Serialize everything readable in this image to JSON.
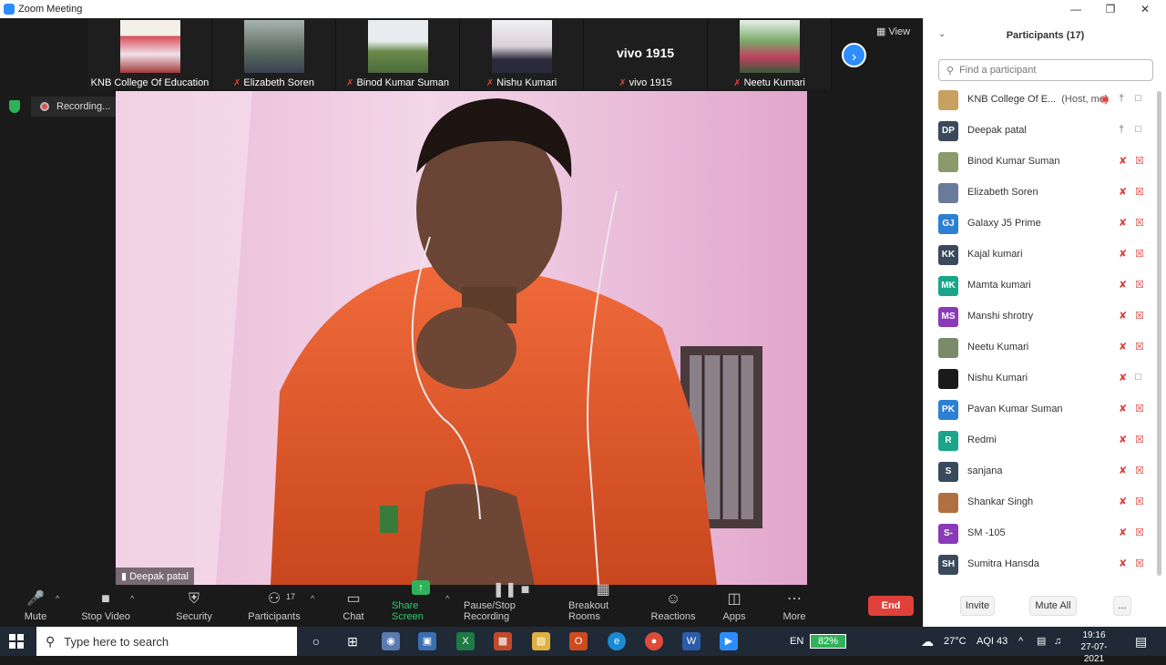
{
  "window": {
    "title": "Zoom Meeting"
  },
  "gallery": {
    "tiles": [
      {
        "name": "KNB College Of Education",
        "muted": false
      },
      {
        "name": "Elizabeth Soren",
        "muted": true
      },
      {
        "name": "Binod Kumar Suman",
        "muted": true
      },
      {
        "name": "Nishu Kumari",
        "muted": true
      },
      {
        "name": "vivo 1915",
        "muted": true,
        "display_text": "vivo 1915"
      },
      {
        "name": "Neetu Kumari",
        "muted": true
      }
    ],
    "view_label": "View"
  },
  "recording": {
    "label": "Recording..."
  },
  "active_speaker": {
    "name": "Deepak patal"
  },
  "toolbar": {
    "mute": "Mute",
    "stop_video": "Stop Video",
    "security": "Security",
    "participants": "Participants",
    "participants_count": "17",
    "chat": "Chat",
    "share_screen": "Share Screen",
    "pause_stop_recording": "Pause/Stop Recording",
    "breakout_rooms": "Breakout Rooms",
    "reactions": "Reactions",
    "apps": "Apps",
    "more": "More",
    "end": "End"
  },
  "participants_panel": {
    "title": "Participants (17)",
    "search_placeholder": "Find a participant",
    "items": [
      {
        "name": "KNB College Of E...",
        "role": "(Host, me)",
        "initials": "",
        "color": "#c8a060",
        "mic": "on",
        "video": "on",
        "recording": true
      },
      {
        "name": "Deepak patal",
        "role": "",
        "initials": "DP",
        "color": "#3a4a5c",
        "mic": "on",
        "video": "on"
      },
      {
        "name": "Binod Kumar Suman",
        "role": "",
        "initials": "",
        "color": "#8a9a6a",
        "mic": "off",
        "video": "off"
      },
      {
        "name": "Elizabeth Soren",
        "role": "",
        "initials": "",
        "color": "#6a7a9a",
        "mic": "off",
        "video": "off"
      },
      {
        "name": "Galaxy J5 Prime",
        "role": "",
        "initials": "GJ",
        "color": "#2d7fd4",
        "mic": "off",
        "video": "off"
      },
      {
        "name": "Kajal kumari",
        "role": "",
        "initials": "KK",
        "color": "#3a4a5c",
        "mic": "off",
        "video": "off"
      },
      {
        "name": "Mamta kumari",
        "role": "",
        "initials": "MK",
        "color": "#1aa58a",
        "mic": "off",
        "video": "off"
      },
      {
        "name": "Manshi shrotry",
        "role": "",
        "initials": "MS",
        "color": "#8a3ab9",
        "mic": "off",
        "video": "off"
      },
      {
        "name": "Neetu Kumari",
        "role": "",
        "initials": "",
        "color": "#7a8a6a",
        "mic": "off",
        "video": "off"
      },
      {
        "name": "Nishu Kumari",
        "role": "",
        "initials": "",
        "color": "#1a1a1a",
        "mic": "off",
        "video": "on"
      },
      {
        "name": "Pavan Kumar Suman",
        "role": "",
        "initials": "PK",
        "color": "#2d7fd4",
        "mic": "off",
        "video": "off"
      },
      {
        "name": "Redmi",
        "role": "",
        "initials": "R",
        "color": "#1aa58a",
        "mic": "off",
        "video": "off"
      },
      {
        "name": "sanjana",
        "role": "",
        "initials": "S",
        "color": "#3a4a5c",
        "mic": "off",
        "video": "off"
      },
      {
        "name": "Shankar Singh",
        "role": "",
        "initials": "",
        "color": "#b07040",
        "mic": "off",
        "video": "off"
      },
      {
        "name": "SM -105",
        "role": "",
        "initials": "S-",
        "color": "#8a3ab9",
        "mic": "off",
        "video": "off"
      },
      {
        "name": "Sumitra Hansda",
        "role": "",
        "initials": "SH",
        "color": "#3a4a5c",
        "mic": "off",
        "video": "off"
      }
    ],
    "invite": "Invite",
    "mute_all": "Mute All",
    "more": "..."
  },
  "taskbar": {
    "search_placeholder": "Type here to search",
    "language": "EN",
    "battery": "82%",
    "weather": "27°C",
    "aqi": "AQI 43",
    "time": "19:16",
    "date": "27-07-2021"
  }
}
